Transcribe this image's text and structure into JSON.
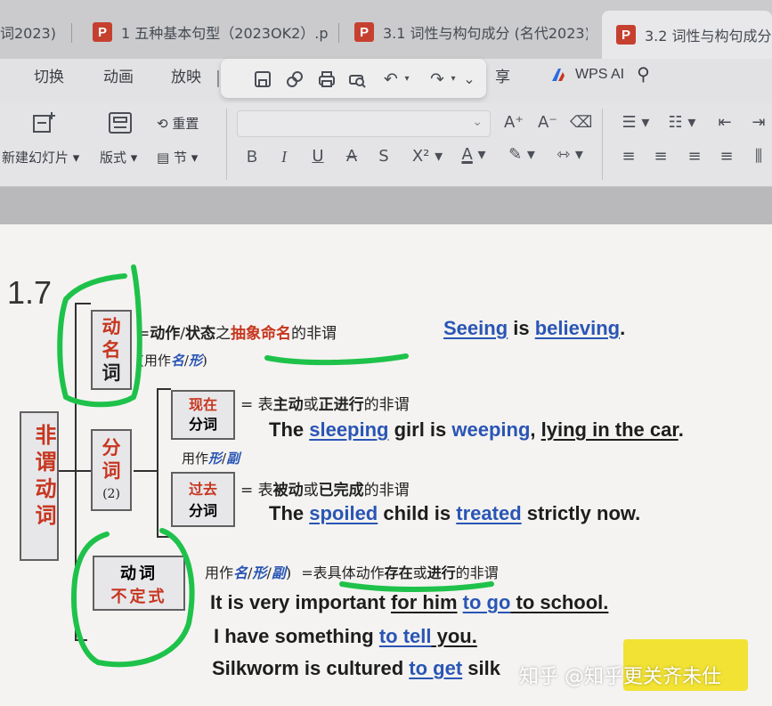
{
  "tabs": [
    {
      "label": "词2023)",
      "active": false
    },
    {
      "label": "1 五种基本句型（2023OK2）.p",
      "active": false
    },
    {
      "label": "3.1 词性与构句成分 (名代2023)",
      "active": false
    },
    {
      "label": "3.2 词性与构句成分 (",
      "active": true
    }
  ],
  "ribbon_tabs": [
    "切换",
    "动画",
    "放映"
  ],
  "ribbon_share_label": "享",
  "wps_ai_label": "WPS AI",
  "ribbon": {
    "new_slide_label": "新建幻灯片",
    "layout_label": "版式",
    "reset_label": "重置",
    "section_label": "节",
    "superscript_label": "X²"
  },
  "slide": {
    "number": "1.7",
    "left_box_label": "非谓动词",
    "gerund": {
      "label_lines": [
        "动",
        "名",
        "词"
      ],
      "definition_parts": [
        "=",
        "动作",
        "/",
        "状态",
        "之",
        "抽象命名",
        "的非谓"
      ],
      "usage": [
        "(用作",
        "名",
        "/",
        "形",
        ")"
      ],
      "example": [
        "Seeing",
        " is ",
        "believing",
        "."
      ]
    },
    "participle": {
      "label_lines": [
        "分",
        "词",
        "(2)"
      ],
      "usage": [
        "用作",
        "形",
        "/",
        "副"
      ],
      "present": {
        "label_lines": [
          "现在",
          "分词"
        ],
        "definition_parts": [
          "= 表",
          "主动",
          "或",
          "正进行",
          "的非谓"
        ],
        "example": [
          "The ",
          "sleeping",
          " girl is ",
          "weeping",
          ", ",
          "lying in the car",
          "."
        ]
      },
      "past": {
        "label_lines": [
          "过去",
          "分词"
        ],
        "definition_parts": [
          "= 表",
          "被动",
          "或",
          "已完成",
          "的非谓"
        ],
        "example": [
          "The ",
          "spoiled",
          " child is ",
          "treated",
          " strictly now."
        ]
      }
    },
    "infinitive": {
      "label_lines": [
        "动词",
        "不定式"
      ],
      "usage_parts": [
        "用作",
        "名",
        "/",
        "形",
        "/",
        "副",
        ")"
      ],
      "definition_parts": [
        "=表具体动作",
        "存在",
        "或",
        "进行",
        "的非谓"
      ],
      "examples": [
        [
          "It is very important ",
          "for him",
          " ",
          "to go",
          " to school."
        ],
        [
          "I have something ",
          "to tell",
          " you."
        ],
        [
          "Silkworm is cultured ",
          "to get",
          " silk"
        ]
      ]
    }
  },
  "watermark": "知乎 @知乎更关齐未仕",
  "colors": {
    "annotation_green": "#1ec24a",
    "accent_red": "#c7361f",
    "accent_blue": "#2a55b5",
    "sticker_yellow": "#f2e233"
  }
}
